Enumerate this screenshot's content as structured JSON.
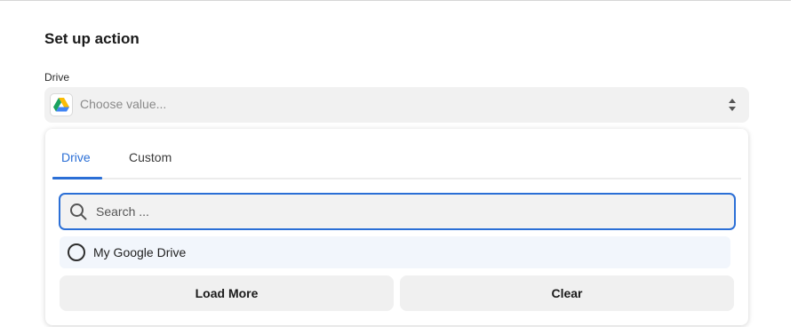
{
  "section": {
    "title": "Set up action"
  },
  "drive_field": {
    "label": "Drive",
    "placeholder": "Choose value...",
    "icon": "google-drive-icon"
  },
  "dropdown": {
    "tabs": [
      {
        "label": "Drive",
        "active": true
      },
      {
        "label": "Custom",
        "active": false
      }
    ],
    "search": {
      "placeholder": "Search ...",
      "value": ""
    },
    "options": [
      {
        "label": "My Google Drive",
        "selected": false
      }
    ],
    "load_more_label": "Load More",
    "clear_label": "Clear"
  },
  "colors": {
    "accent": "#2b6fd6",
    "field_bg": "#f1f1f1",
    "option_hover_bg": "#f2f6fc"
  }
}
